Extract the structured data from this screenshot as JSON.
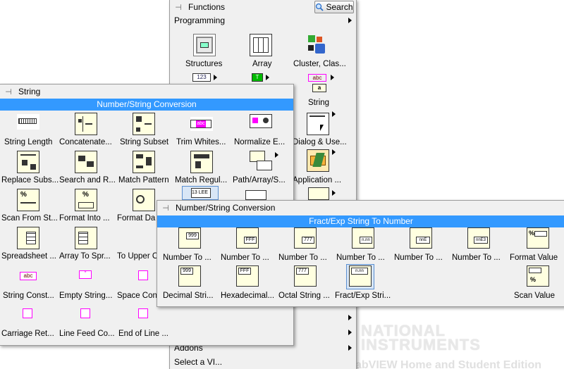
{
  "functions_palette": {
    "title": "Functions",
    "search_label": "Search",
    "category": "Programming",
    "items": [
      {
        "label": "Structures"
      },
      {
        "label": "Array"
      },
      {
        "label": "Cluster, Clas..."
      },
      {
        "label": "String"
      },
      {
        "label": "Dialog & Use..."
      },
      {
        "label": "Application ..."
      }
    ],
    "bottom_rows": [
      "Addons",
      "Select a VI..."
    ]
  },
  "string_palette": {
    "title": "String",
    "subtitle": "Number/String Conversion",
    "items": [
      "String Length",
      "Concatenate...",
      "String Subset",
      "Trim Whites...",
      "Normalize E...",
      "Replace Subs...",
      "Search and R...",
      "Match Pattern",
      "Match Regul...",
      "Path/Array/S...",
      "Scan From St...",
      "Format Into ...",
      "Format Da",
      "Spreadsheet ...",
      "Array To Spr...",
      "To Upper C",
      "String Const...",
      "Empty String...",
      "Space Con",
      "Carriage Ret...",
      "Line Feed Co...",
      "End of Line ..."
    ]
  },
  "numstr_palette": {
    "title": "Number/String Conversion",
    "subtitle": "Fract/Exp String To Number",
    "row1": [
      "Number To ...",
      "Number To ...",
      "Number To ...",
      "Number To ...",
      "Number To ...",
      "Number To ...",
      "Format Value"
    ],
    "row2": [
      "Decimal Stri...",
      "Hexadecimal...",
      "Octal String ...",
      "Fract/Exp Stri...",
      "Scan Value"
    ]
  },
  "splash": {
    "brand_line1": "NATIONAL",
    "brand_line2": "INSTRUMENTS",
    "edition": "abVIEW Home and Student Edition"
  },
  "colors": {
    "accent": "#3399ff",
    "icon_bg": "#ffffe0",
    "string_pink": "#ff00ff"
  }
}
